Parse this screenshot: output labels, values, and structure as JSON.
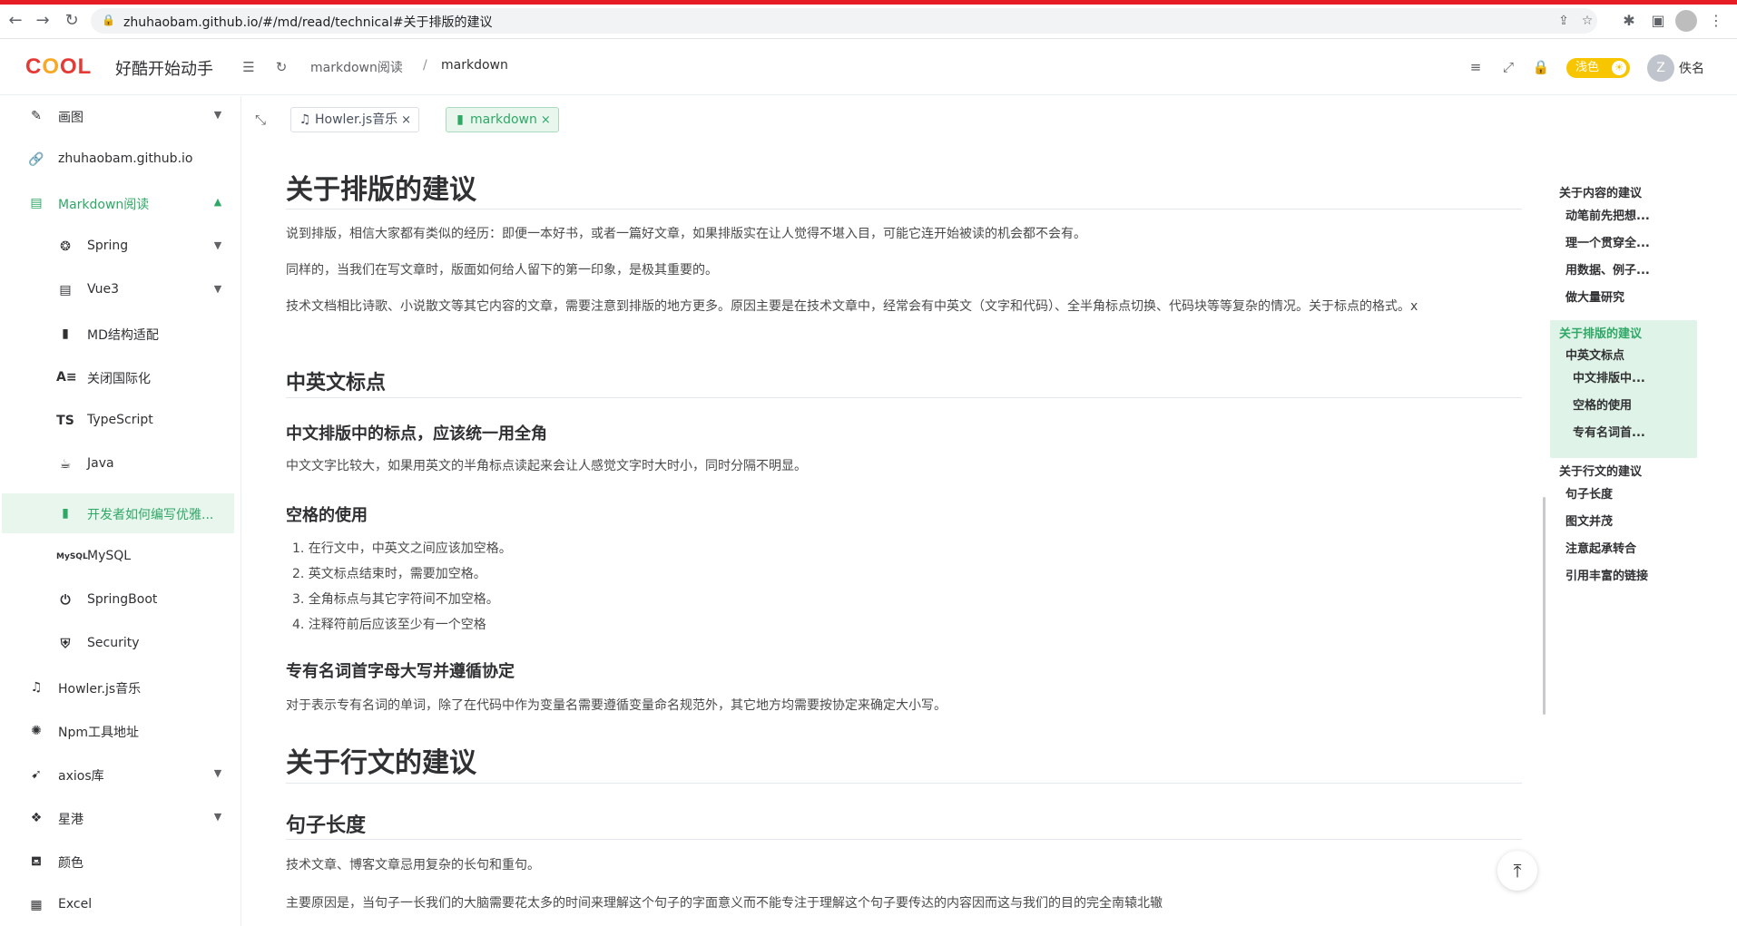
{
  "browser": {
    "url": "zhuhaobam.github.io/#/md/read/technical#关于排版的建议"
  },
  "header": {
    "site_title": "好酷开始动手",
    "breadcrumb": [
      "markdown阅读",
      "/",
      "markdown"
    ],
    "theme_label": "浅色",
    "avatar_letter": "Z",
    "username": "佚名"
  },
  "sidebar": {
    "items": [
      {
        "label": "画图",
        "icon": "brush-icon"
      },
      {
        "label": "zhuhaobam.github.io",
        "icon": "link-icon"
      },
      {
        "label": "Markdown阅读",
        "icon": "book-icon"
      },
      {
        "label": "Spring",
        "icon": "spring-icon"
      },
      {
        "label": "Vue3",
        "icon": "book-icon"
      },
      {
        "label": "MD结构适配",
        "icon": "markdown-file-icon"
      },
      {
        "label": "关闭国际化",
        "icon": "translate-icon"
      },
      {
        "label": "TypeScript",
        "icon": "ts-icon"
      },
      {
        "label": "Java",
        "icon": "java-icon"
      },
      {
        "label": "开发者如何编写优雅...",
        "icon": "markdown-file-icon"
      },
      {
        "label": "MySQL",
        "icon": "mysql-icon"
      },
      {
        "label": "SpringBoot",
        "icon": "power-icon"
      },
      {
        "label": "Security",
        "icon": "shield-icon"
      },
      {
        "label": "Howler.js音乐",
        "icon": "music-icon"
      },
      {
        "label": "Npm工具地址",
        "icon": "octopus-icon"
      },
      {
        "label": "axios库",
        "icon": "rocket-icon"
      },
      {
        "label": "星港",
        "icon": "dropbox-icon"
      },
      {
        "label": "颜色",
        "icon": "paint-bucket-icon"
      },
      {
        "label": "Excel",
        "icon": "excel-icon"
      }
    ]
  },
  "tabs": [
    {
      "label": "Howler.js音乐",
      "close": "×"
    },
    {
      "label": "markdown",
      "close": "×"
    }
  ],
  "article": {
    "h1_typesetting": "关于排版的建议",
    "p1": "说到排版，相信大家都有类似的经历：即便一本好书，或者一篇好文章，如果排版实在让人觉得不堪入目，可能它连开始被读的机会都不会有。",
    "p2": "同样的，当我们在写文章时，版面如何给人留下的第一印象，是极其重要的。",
    "p3": "技术文档相比诗歌、小说散文等其它内容的文章，需要注意到排版的地方更多。原因主要是在技术文章中，经常会有中英文（文字和代码）、全半角标点切换、代码块等等复杂的情况。关于标点的格式。x",
    "h2_punct": "中英文标点",
    "h3_fullwidth": "中文排版中的标点，应该统一用全角",
    "p4": "中文文字比较大，如果用英文的半角标点读起来会让人感觉文字时大时小，同时分隔不明显。",
    "h3_spaces": "空格的使用",
    "spaces_list": [
      "1. 在行文中，中英文之间应该加空格。",
      "2. 英文标点结束时，需要加空格。",
      "3. 全角标点与其它字符间不加空格。",
      "4. 注释符前后应该至少有一个空格"
    ],
    "h3_proper": "专有名词首字母大写并遵循协定",
    "p5": "对于表示专有名词的单词，除了在代码中作为变量名需要遵循变量命名规范外，其它地方均需要按协定来确定大小写。",
    "h1_writing": "关于行文的建议",
    "h2_sentence": "句子长度",
    "p6": "技术文章、博客文章忌用复杂的长句和重句。",
    "p7": "主要原因是，当句子一长我们的大脑需要花太多的时间来理解这个句子的字面意义而不能专注于理解这个句子要传达的内容因而这与我们的目的完全南辕北辙"
  },
  "toc": {
    "items": [
      "关于内容的建议",
      "动笔前先把想...",
      "理一个贯穿全...",
      "用数据、例子...",
      "做大量研究",
      "关于排版的建议",
      "中英文标点",
      "中文排版中...",
      "空格的使用",
      "专有名词首...",
      "关于行文的建议",
      "句子长度",
      "图文并茂",
      "注意起承转合",
      "引用丰富的链接"
    ]
  },
  "colors": {
    "accent": "#2fa866",
    "theme_pill": "#f7c600",
    "top_line": "#e51c23"
  }
}
